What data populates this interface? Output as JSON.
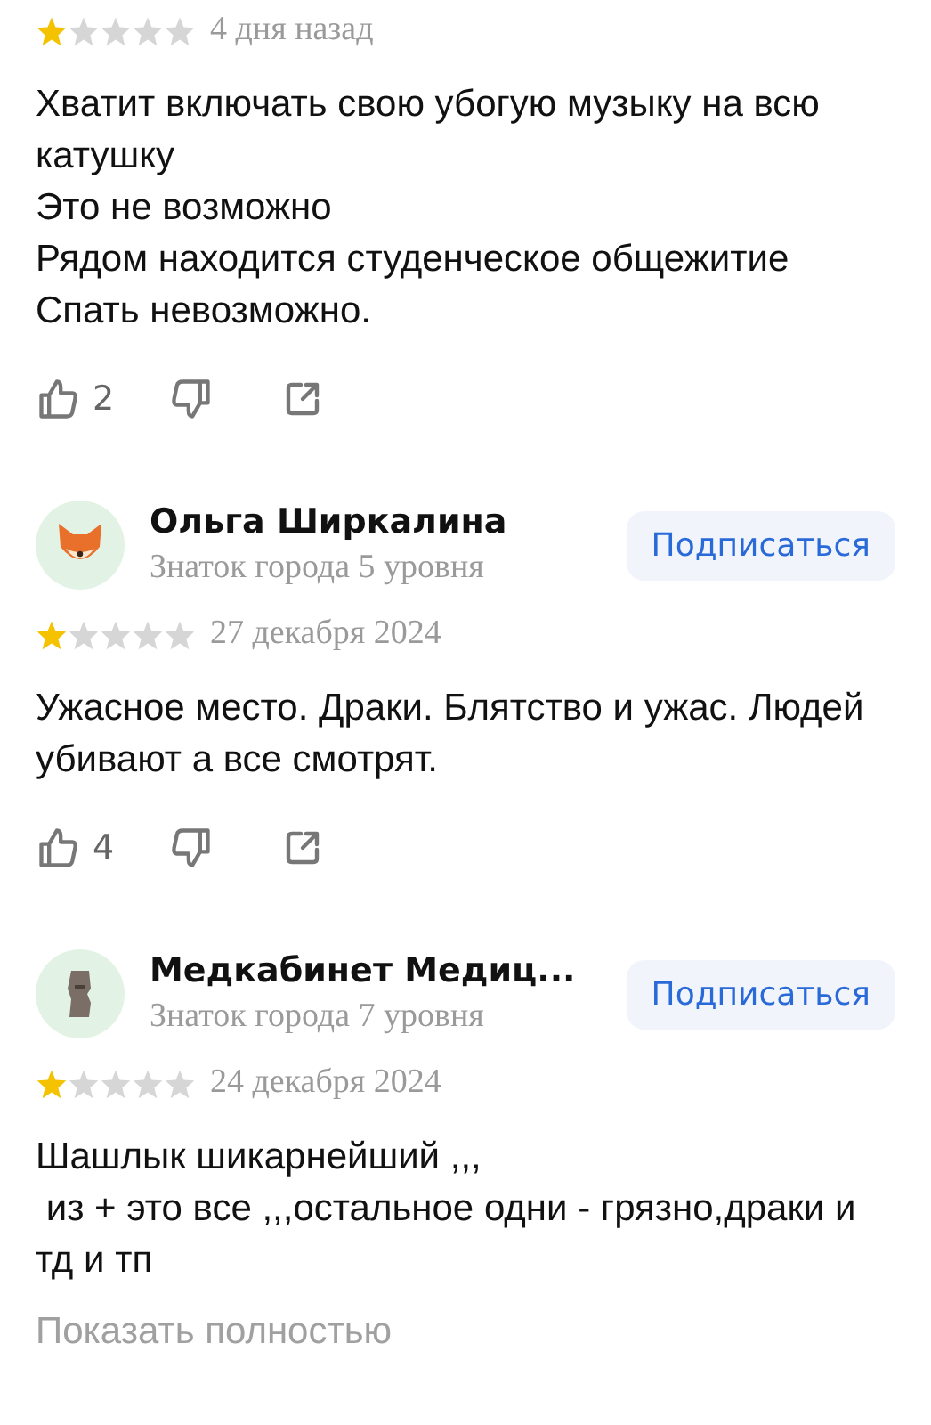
{
  "reviews": [
    {
      "stars": 1,
      "date": "4 дня назад",
      "text": [
        "Хватит включать свою убогую музыку на всю катушку",
        "Это не возможно",
        "Рядом находится студенческое общежитие",
        "Спать невозможно."
      ],
      "likes": "2"
    },
    {
      "author": {
        "name": "Ольга Ширкалина",
        "level": "Знаток города 5 уровня",
        "avatar": {
          "kind": "fox"
        },
        "subscribe": "Подписаться"
      },
      "stars": 1,
      "date": "27 декабря 2024",
      "text": [
        "Ужасное место. Драки. Блятство и ужас. Людей убивают а все смотрят."
      ],
      "likes": "4"
    },
    {
      "author": {
        "name": "Медкабинет Медиц...",
        "level": "Знаток города 7 уровня",
        "avatar": {
          "kind": "statue"
        },
        "subscribe": "Подписаться"
      },
      "stars": 1,
      "date": "24 декабря 2024",
      "text": [
        "Шашлык шикарнейший ,,,",
        " из + это все ,,,остальное одни - грязно,драки и тд и тп"
      ],
      "more": "Показать полностью"
    }
  ]
}
